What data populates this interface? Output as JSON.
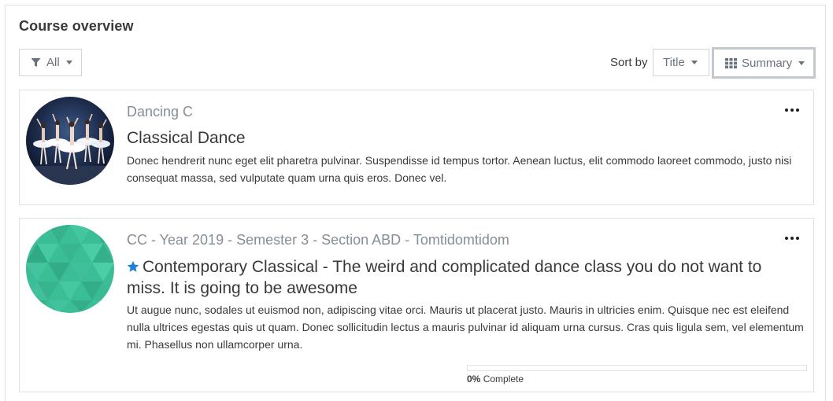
{
  "block": {
    "title": "Course overview"
  },
  "toolbar": {
    "filter_label": "All",
    "sort_by_label": "Sort by",
    "sort_value": "Title",
    "view_value": "Summary"
  },
  "courses": [
    {
      "category": "Dancing C",
      "name": "Classical Dance",
      "starred": false,
      "summary": "Donec hendrerit nunc eget elit pharetra pulvinar. Suspendisse id tempus tortor. Aenean luctus, elit commodo laoreet commodo, justo nisi consequat massa, sed vulputate quam urna quis eros. Donec vel.",
      "image": "ballet-dancers-photo"
    },
    {
      "category": "CC - Year 2019 - Semester 3 - Section ABD - Tomtidomtidom",
      "name": "Contemporary Classical - The weird and complicated dance class you do not want to miss. It is going to be awesome",
      "starred": true,
      "summary": "Ut augue nunc, sodales ut euismod non, adipiscing vitae orci. Mauris ut placerat justo. Mauris in ultricies enim. Quisque nec est eleifend nulla ultrices egestas quis ut quam. Donec sollicitudin lectus a mauris pulvinar id aliquam urna cursus. Cras quis ligula sem, vel elementum mi. Phasellus non ullamcorper urna.",
      "image": "green-triangle-pattern",
      "progress_percent": "0%",
      "progress_suffix": "Complete",
      "progress_fraction": 0
    }
  ],
  "colors": {
    "star": "#1f7ed6",
    "pattern_green": "#3bbd96",
    "border": "#dee2e6"
  }
}
